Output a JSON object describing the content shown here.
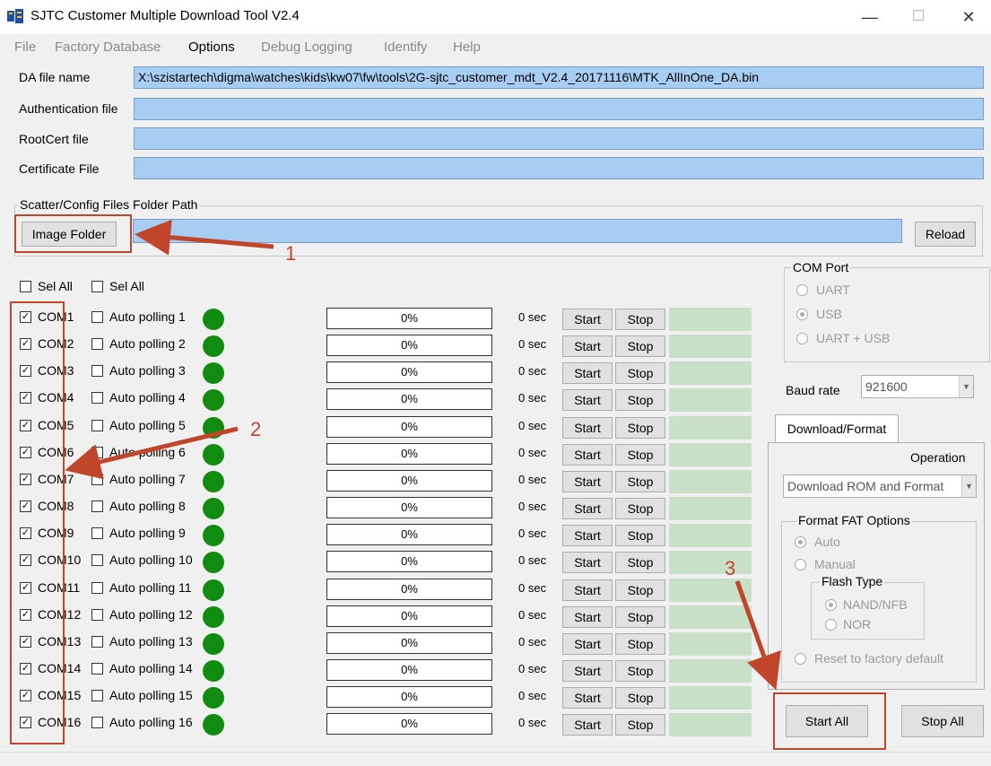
{
  "window": {
    "title": "SJTC Customer Multiple Download Tool V2.4",
    "minimize": "—",
    "maximize": "☐",
    "close": "✕"
  },
  "menu": {
    "items": [
      "File",
      "Factory Database",
      "Options",
      "Debug Logging",
      "Identify",
      "Help"
    ]
  },
  "files": {
    "da_label": "DA file name",
    "da_value": "X:\\szistartech\\digma\\watches\\kids\\kw07\\fw\\tools\\2G-sjtc_customer_mdt_V2.4_20171116\\MTK_AllInOne_DA.bin",
    "auth_label": "Authentication file",
    "auth_value": "",
    "rootcert_label": "RootCert file",
    "rootcert_value": "",
    "cert_label": "Certificate File",
    "cert_value": ""
  },
  "scatter": {
    "group_title": "Scatter/Config Files Folder Path",
    "image_folder": "Image Folder",
    "path_value": "",
    "reload": "Reload"
  },
  "selall": {
    "label1": "Sel All",
    "label2": "Sel All"
  },
  "ports": [
    {
      "com": "COM1",
      "poll": "Auto polling 1",
      "progress": "0%",
      "time": "0 sec",
      "checked": true
    },
    {
      "com": "COM2",
      "poll": "Auto polling 2",
      "progress": "0%",
      "time": "0 sec",
      "checked": true
    },
    {
      "com": "COM3",
      "poll": "Auto polling 3",
      "progress": "0%",
      "time": "0 sec",
      "checked": true
    },
    {
      "com": "COM4",
      "poll": "Auto polling 4",
      "progress": "0%",
      "time": "0 sec",
      "checked": true
    },
    {
      "com": "COM5",
      "poll": "Auto polling 5",
      "progress": "0%",
      "time": "0 sec",
      "checked": true
    },
    {
      "com": "COM6",
      "poll": "Auto polling 6",
      "progress": "0%",
      "time": "0 sec",
      "checked": true
    },
    {
      "com": "COM7",
      "poll": "Auto polling 7",
      "progress": "0%",
      "time": "0 sec",
      "checked": true
    },
    {
      "com": "COM8",
      "poll": "Auto polling 8",
      "progress": "0%",
      "time": "0 sec",
      "checked": true
    },
    {
      "com": "COM9",
      "poll": "Auto polling 9",
      "progress": "0%",
      "time": "0 sec",
      "checked": true
    },
    {
      "com": "COM10",
      "poll": "Auto polling 10",
      "progress": "0%",
      "time": "0 sec",
      "checked": true
    },
    {
      "com": "COM11",
      "poll": "Auto polling 11",
      "progress": "0%",
      "time": "0 sec",
      "checked": true
    },
    {
      "com": "COM12",
      "poll": "Auto polling 12",
      "progress": "0%",
      "time": "0 sec",
      "checked": true
    },
    {
      "com": "COM13",
      "poll": "Auto polling 13",
      "progress": "0%",
      "time": "0 sec",
      "checked": true
    },
    {
      "com": "COM14",
      "poll": "Auto polling 14",
      "progress": "0%",
      "time": "0 sec",
      "checked": true
    },
    {
      "com": "COM15",
      "poll": "Auto polling 15",
      "progress": "0%",
      "time": "0 sec",
      "checked": true
    },
    {
      "com": "COM16",
      "poll": "Auto polling 16",
      "progress": "0%",
      "time": "0 sec",
      "checked": true
    }
  ],
  "row_buttons": {
    "start": "Start",
    "stop": "Stop"
  },
  "comport": {
    "title": "COM Port",
    "uart": "UART",
    "usb": "USB",
    "uart_usb": "UART + USB",
    "selected": "USB"
  },
  "baud": {
    "label": "Baud rate",
    "value": "921600"
  },
  "tabs": {
    "download_format": "Download/Format"
  },
  "operation": {
    "label": "Operation",
    "value": "Download ROM and Format"
  },
  "fat": {
    "title": "Format FAT Options",
    "auto": "Auto",
    "manual": "Manual",
    "flash_type": "Flash  Type",
    "nand": "NAND/NFB",
    "nor": "NOR",
    "reset": "Reset to factory default"
  },
  "actions": {
    "start_all": "Start All",
    "stop_all": "Stop All"
  },
  "annotations": {
    "n1": "1",
    "n2": "2",
    "n3": "3"
  },
  "colors": {
    "field_blue": "#a8cdf2",
    "led_green": "#118c11",
    "status_green": "#c8e0c8",
    "annotation_red": "#c0452b"
  }
}
